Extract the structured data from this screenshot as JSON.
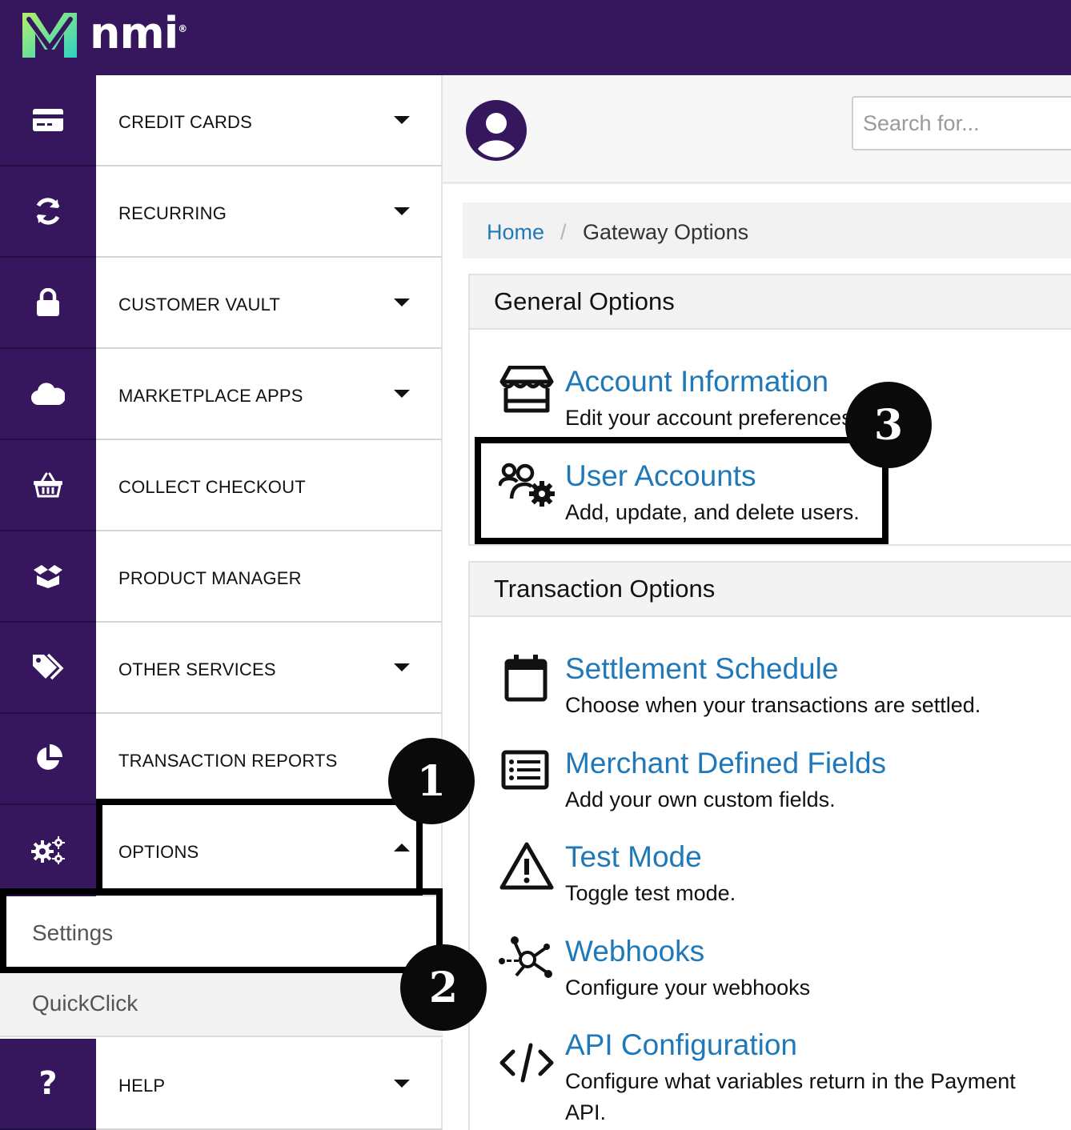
{
  "brand": {
    "name": "nmi",
    "trademark": "®"
  },
  "sidebar": {
    "items": [
      {
        "label": "CREDIT CARDS",
        "icon": "credit-card-icon",
        "has_caret": true
      },
      {
        "label": "RECURRING",
        "icon": "sync-icon",
        "has_caret": true
      },
      {
        "label": "CUSTOMER VAULT",
        "icon": "lock-icon",
        "has_caret": true
      },
      {
        "label": "MARKETPLACE APPS",
        "icon": "cloud-icon",
        "has_caret": true
      },
      {
        "label": "COLLECT CHECKOUT",
        "icon": "basket-icon",
        "has_caret": false
      },
      {
        "label": "PRODUCT MANAGER",
        "icon": "box-icon",
        "has_caret": false
      },
      {
        "label": "OTHER SERVICES",
        "icon": "tags-icon",
        "has_caret": true
      },
      {
        "label": "TRANSACTION REPORTS",
        "icon": "pie-chart-icon",
        "has_caret": false
      },
      {
        "label": "OPTIONS",
        "icon": "gears-icon",
        "has_caret": true,
        "expanded": true
      },
      {
        "label": "HELP",
        "icon": "question-icon",
        "has_caret": true
      }
    ],
    "options_submenu": [
      {
        "label": "Settings",
        "active": true
      },
      {
        "label": "QuickClick",
        "active": false
      }
    ]
  },
  "header": {
    "avatar_icon": "user-circle-icon",
    "search_placeholder": "Search for..."
  },
  "breadcrumb": {
    "home": "Home",
    "separator": "/",
    "current": "Gateway Options"
  },
  "general_options": {
    "title": "General Options",
    "items": [
      {
        "title": "Account Information",
        "desc": "Edit your account preferences.",
        "icon": "store-icon"
      },
      {
        "title": "User Accounts",
        "desc": "Add, update, and delete users.",
        "icon": "users-gear-icon"
      }
    ]
  },
  "transaction_options": {
    "title": "Transaction Options",
    "items": [
      {
        "title": "Settlement Schedule",
        "desc": "Choose when your transactions are settled.",
        "icon": "calendar-icon"
      },
      {
        "title": "Merchant Defined Fields",
        "desc": "Add your own custom fields.",
        "icon": "list-icon"
      },
      {
        "title": "Test Mode",
        "desc": "Toggle test mode.",
        "icon": "warning-icon"
      },
      {
        "title": "Webhooks",
        "desc": "Configure your webhooks",
        "icon": "webhook-icon"
      },
      {
        "title": "API Configuration",
        "desc": "Configure what variables return in the Payment API.",
        "icon": "code-icon"
      }
    ]
  },
  "annotations": {
    "step1": "1",
    "step2": "2",
    "step3": "3"
  },
  "colors": {
    "brand_purple": "#36175e",
    "link_blue": "#1f79b8",
    "logo_green": "#8be07a",
    "logo_teal": "#2fd1c4"
  }
}
